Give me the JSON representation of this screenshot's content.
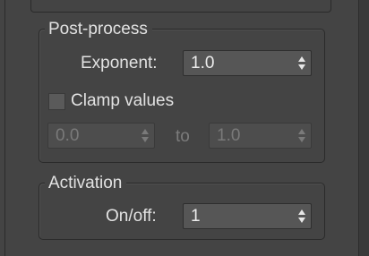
{
  "post_process": {
    "title": "Post-process",
    "exponent_label": "Exponent:",
    "exponent_value": "1.0",
    "clamp_label": "Clamp values",
    "clamp_checked": false,
    "clamp_min_value": "0.0",
    "to_label": "to",
    "clamp_max_value": "1.0"
  },
  "activation": {
    "title": "Activation",
    "onoff_label": "On/off:",
    "onoff_value": "1"
  },
  "colors": {
    "panel_bg": "#444444",
    "field_bg": "#565656",
    "text": "#e2e2e2",
    "disabled_text": "#7a7a7a"
  }
}
